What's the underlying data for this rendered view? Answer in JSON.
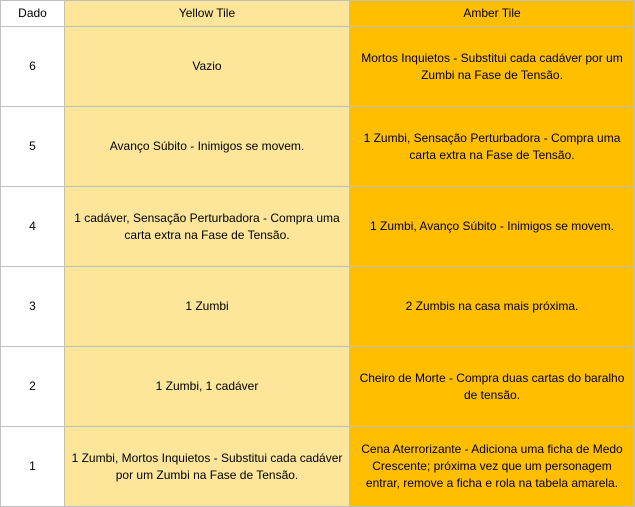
{
  "headers": {
    "dado": "Dado",
    "yellow": "Yellow Tile",
    "amber": "Amber Tile"
  },
  "rows": [
    {
      "dado": "6",
      "yellow": "Vazio",
      "amber": "Mortos Inquietos - Substitui cada cadáver por um Zumbi na Fase de Tensão."
    },
    {
      "dado": "5",
      "yellow": "Avanço Súbito - Inimigos se movem.",
      "amber": "1 Zumbi, Sensação Perturbadora - Compra uma carta extra na Fase de Tensão."
    },
    {
      "dado": "4",
      "yellow": "1 cadáver, Sensação Perturbadora - Compra uma carta extra na Fase de Tensão.",
      "amber": "1 Zumbi, Avanço Súbito - Inimigos se movem."
    },
    {
      "dado": "3",
      "yellow": "1 Zumbi",
      "amber": "2 Zumbis na casa mais próxima."
    },
    {
      "dado": "2",
      "yellow": "1 Zumbi, 1 cadáver",
      "amber": "Cheiro de Morte - Compra duas cartas do baralho de tensão."
    },
    {
      "dado": "1",
      "yellow": "1 Zumbi, Mortos Inquietos - Substitui cada cadáver por um Zumbi na Fase de Tensão.",
      "amber": "Cena Aterrorizante - Adiciona uma ficha de Medo Crescente; próxima vez que um personagem entrar, remove a ficha e rola na tabela amarela."
    }
  ],
  "colors": {
    "yellow": "#fde69a",
    "amber": "#ffbf00",
    "border": "#c0c0c0"
  }
}
